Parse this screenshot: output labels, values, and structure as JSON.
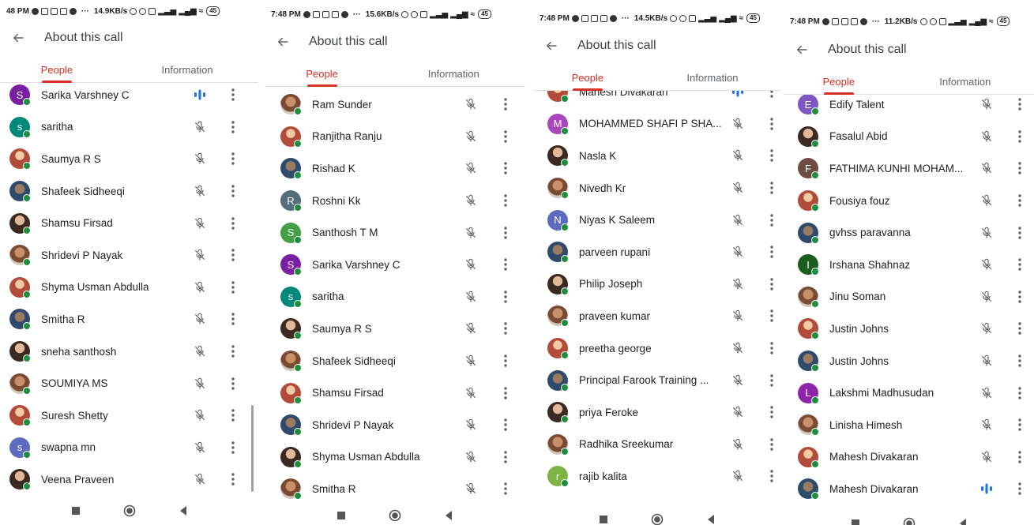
{
  "panels": [
    {
      "status": {
        "time": "48 PM",
        "speed": "14.9KB/s",
        "battery": "45"
      },
      "title": "About this call",
      "tabs": [
        "People",
        "Information"
      ],
      "rows": [
        {
          "name": "Sarika Varshney C",
          "avatar": "letter",
          "letter": "S",
          "color": "#7b1fa2",
          "status": "speaking"
        },
        {
          "name": "saritha",
          "avatar": "letter",
          "letter": "s",
          "color": "#00897b",
          "status": "muted"
        },
        {
          "name": "Saumya R S",
          "avatar": "photo",
          "status": "muted"
        },
        {
          "name": "Shafeek Sidheeqi",
          "avatar": "photo",
          "status": "muted"
        },
        {
          "name": "Shamsu Firsad",
          "avatar": "photo",
          "status": "muted"
        },
        {
          "name": "Shridevi P Nayak",
          "avatar": "photo",
          "status": "muted"
        },
        {
          "name": "Shyma Usman Abdulla",
          "avatar": "photo",
          "status": "muted"
        },
        {
          "name": "Smitha R",
          "avatar": "photo",
          "status": "muted"
        },
        {
          "name": "sneha santhosh",
          "avatar": "photo",
          "status": "muted"
        },
        {
          "name": "SOUMIYA MS",
          "avatar": "photo",
          "status": "muted"
        },
        {
          "name": "Suresh Shetty",
          "avatar": "photo",
          "status": "muted"
        },
        {
          "name": "swapna mn",
          "avatar": "letter",
          "letter": "s",
          "color": "#5c6bc0",
          "status": "muted"
        },
        {
          "name": "Veena Praveen",
          "avatar": "photo",
          "status": "muted"
        }
      ]
    },
    {
      "status": {
        "time": "7:48 PM",
        "speed": "15.6KB/s",
        "battery": "45"
      },
      "title": "About this call",
      "tabs": [
        "People",
        "Information"
      ],
      "rows": [
        {
          "name": "Ram Sunder",
          "avatar": "photo",
          "status": "muted"
        },
        {
          "name": "Ranjitha Ranju",
          "avatar": "photo",
          "status": "muted"
        },
        {
          "name": "Rishad K",
          "avatar": "photo",
          "status": "muted"
        },
        {
          "name": "Roshni Kk",
          "avatar": "letter",
          "letter": "R",
          "color": "#546e7a",
          "status": "muted"
        },
        {
          "name": "Santhosh T M",
          "avatar": "letter",
          "letter": "S",
          "color": "#43a047",
          "status": "muted"
        },
        {
          "name": "Sarika Varshney C",
          "avatar": "letter",
          "letter": "S",
          "color": "#7b1fa2",
          "status": "muted"
        },
        {
          "name": "saritha",
          "avatar": "letter",
          "letter": "s",
          "color": "#00897b",
          "status": "muted"
        },
        {
          "name": "Saumya R S",
          "avatar": "photo",
          "status": "muted"
        },
        {
          "name": "Shafeek Sidheeqi",
          "avatar": "photo",
          "status": "muted"
        },
        {
          "name": "Shamsu Firsad",
          "avatar": "photo",
          "status": "muted"
        },
        {
          "name": "Shridevi P Nayak",
          "avatar": "photo",
          "status": "muted"
        },
        {
          "name": "Shyma Usman Abdulla",
          "avatar": "photo",
          "status": "muted"
        },
        {
          "name": "Smitha R",
          "avatar": "photo",
          "status": "muted"
        }
      ]
    },
    {
      "status": {
        "time": "7:48 PM",
        "speed": "14.5KB/s",
        "battery": "45"
      },
      "title": "About this call",
      "tabs": [
        "People",
        "Information"
      ],
      "rows": [
        {
          "name": "Mahesh Divakaran",
          "avatar": "photo",
          "status": "speaking"
        },
        {
          "name": "MOHAMMED SHAFI P SHA...",
          "avatar": "letter",
          "letter": "M",
          "color": "#ab47bc",
          "status": "muted"
        },
        {
          "name": "Nasla K",
          "avatar": "photo",
          "status": "muted"
        },
        {
          "name": "Nivedh Kr",
          "avatar": "photo",
          "status": "muted"
        },
        {
          "name": "Niyas K Saleem",
          "avatar": "letter",
          "letter": "N",
          "color": "#5c6bc0",
          "status": "muted"
        },
        {
          "name": "parveen rupani",
          "avatar": "photo",
          "status": "muted"
        },
        {
          "name": "Philip Joseph",
          "avatar": "photo",
          "status": "muted"
        },
        {
          "name": "praveen kumar",
          "avatar": "photo",
          "status": "muted"
        },
        {
          "name": "preetha george",
          "avatar": "photo",
          "status": "muted"
        },
        {
          "name": "Principal Farook Training ...",
          "avatar": "photo",
          "status": "muted"
        },
        {
          "name": "priya Feroke",
          "avatar": "photo",
          "status": "muted"
        },
        {
          "name": "Radhika Sreekumar",
          "avatar": "photo",
          "status": "muted"
        },
        {
          "name": "rajib kalita",
          "avatar": "letter",
          "letter": "r",
          "color": "#7cb342",
          "status": "muted"
        }
      ]
    },
    {
      "status": {
        "time": "7:48 PM",
        "speed": "11.2KB/s",
        "battery": "45"
      },
      "title": "About this call",
      "tabs": [
        "People",
        "Information"
      ],
      "rows": [
        {
          "name": "Edify Talent",
          "avatar": "letter",
          "letter": "E",
          "color": "#7e57c2",
          "status": "muted"
        },
        {
          "name": "Fasalul Abid",
          "avatar": "photo",
          "status": "muted"
        },
        {
          "name": "FATHIMA KUNHI MOHAM...",
          "avatar": "letter",
          "letter": "F",
          "color": "#6d4c41",
          "status": "muted"
        },
        {
          "name": "Fousiya fouz",
          "avatar": "photo",
          "status": "muted"
        },
        {
          "name": "gvhss paravanna",
          "avatar": "photo",
          "status": "muted"
        },
        {
          "name": "Irshana Shahnaz",
          "avatar": "letter",
          "letter": "I",
          "color": "#1b5e20",
          "status": "muted"
        },
        {
          "name": "Jinu Soman",
          "avatar": "photo",
          "status": "muted"
        },
        {
          "name": "Justin Johns",
          "avatar": "photo",
          "status": "muted"
        },
        {
          "name": "Justin Johns",
          "avatar": "photo",
          "status": "muted"
        },
        {
          "name": "Lakshmi Madhusudan",
          "avatar": "letter",
          "letter": "L",
          "color": "#8e24aa",
          "status": "muted"
        },
        {
          "name": "Linisha Himesh",
          "avatar": "photo",
          "status": "muted"
        },
        {
          "name": "Mahesh Divakaran",
          "avatar": "photo",
          "status": "muted"
        },
        {
          "name": "Mahesh Divakaran",
          "avatar": "photo",
          "status": "speaking"
        }
      ]
    }
  ]
}
